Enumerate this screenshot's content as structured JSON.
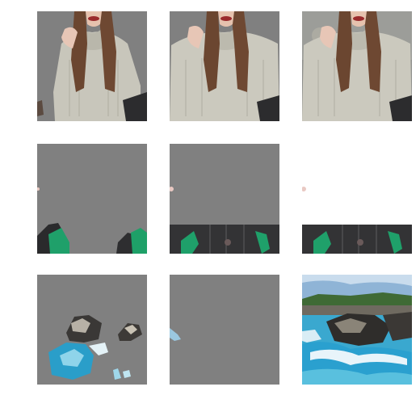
{
  "grid": {
    "rows": 3,
    "columns": 3,
    "background_color": "#ffffff",
    "mask_fill_color": "#808080",
    "cells": [
      {
        "row": 1,
        "column": 1,
        "subject": "woman-in-sweater",
        "variant": "masked"
      },
      {
        "row": 1,
        "column": 2,
        "subject": "woman-in-sweater",
        "variant": "masked"
      },
      {
        "row": 1,
        "column": 3,
        "subject": "woman-in-sweater",
        "variant": "full"
      },
      {
        "row": 2,
        "column": 1,
        "subject": "green-jacket-edges",
        "variant": "masked"
      },
      {
        "row": 2,
        "column": 2,
        "subject": "dark-jacket-strip",
        "variant": "masked"
      },
      {
        "row": 2,
        "column": 3,
        "subject": "dark-jacket-strip",
        "variant": "on-white"
      },
      {
        "row": 3,
        "column": 1,
        "subject": "rocky-coast-water",
        "variant": "masked"
      },
      {
        "row": 3,
        "column": 2,
        "subject": "rocky-coast-water",
        "variant": "masked"
      },
      {
        "row": 3,
        "column": 3,
        "subject": "rocky-coast-water",
        "variant": "full"
      }
    ]
  }
}
